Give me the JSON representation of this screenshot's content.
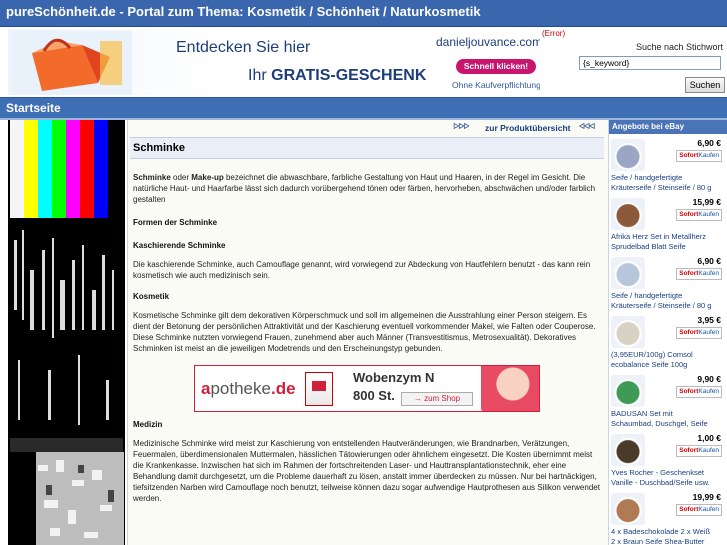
{
  "site": {
    "title": "pureSchönheit.de - Portal zum Thema: Kosmetik / Schönheit / Naturkosmetik"
  },
  "banner": {
    "line1": "Entdecken Sie hier",
    "line2_prefix": "Ihr ",
    "line2_bold": "GRATIS-GESCHENK",
    "brand": "danieljouvance.com",
    "cta": "Schnell klicken!",
    "note": "Ohne Kaufverpflichtung"
  },
  "error_link": "(Error)",
  "search": {
    "label": "Suche nach Stichwort",
    "value": "{s_keyword}",
    "button": "Suchen"
  },
  "nav": {
    "home": "Startseite"
  },
  "product_link": {
    "left_arrows": "ᐅᐅᐅ",
    "label": "zur Produktübersicht",
    "right_arrows": "ᐊᐊᐊ"
  },
  "article": {
    "title": "Schminke",
    "intro": {
      "b1": "Schminke",
      "t1": " oder ",
      "b2": "Make-up",
      "t2": " bezeichnet die abwaschbare, farbliche Gestaltung von Haut und Haaren, in der Regel im Gesicht. Die natürliche Haut- und Haarfarbe lässt sich dadurch vorübergehend tönen oder färben, hervorheben, abschwächen und/oder farblich gestalten"
    },
    "h_formen": "Formen der Schminke",
    "h_kaschierend": "Kaschierende Schminke",
    "p_kaschierend": "Die kaschierende Schminke, auch Camouflage genannt, wird vorwiegend zur Abdeckung von Hautfehlern benutzt - das kann rein kosmetisch wie auch medizinisch sein.",
    "h_kosmetik": "Kosmetik",
    "p_kosmetik": "Kosmetische Schminke gilt dem dekorativen Körperschmuck und soll im allgemeinen die Ausstrahlung einer Person steigern. Es dient der Betonung der persönlichen Attraktivität und der Kaschierung eventuell vorkommender Makel, wie Falten oder Couperose. Diese Schminke nutzten vorwiegend Frauen, zunehmend aber auch Männer (Transvestitismus, Metrosexualität). Dekoratives Schminken ist meist an die jeweiligen Modetrends und den Erscheinungstyp gebunden.",
    "h_medizin": "Medizin",
    "p_medizin": "Medizinische Schminke wird meist zur Kaschierung von entstellenden Hautveränderungen, wie Brandnarben, Verätzungen, Feuermalen, überdimensionalen Muttermalen, hässlichen Tätowierungen oder ähnlichem eingesetzt. Die Kosten übernimmt meist die Krankenkasse. Inzwischen hat sich im Rahmen der fortschreitenden Laser- und Hauttransplantationstechnik, eher eine Behandlung damit durchgesetzt, um die Probleme dauerhaft zu lösen, anstatt immer überdecken zu müssen. Nur bei hartnäckigen, tiefsitzenden Narben wird Camouflage noch benutzt, teilweise können dazu sogar aufwendige Hautprothesen aus Silikon verwendet werden."
  },
  "ad": {
    "brand_a": "a",
    "brand_rest": "potheke",
    "brand_tld": ".de",
    "product": "Wobenzym N",
    "qty": "800 St.",
    "button": "→ zum Shop"
  },
  "ebay": {
    "header": "Angebote bei eBay",
    "buy_label_red": "Sofort",
    "buy_label": "Kaufen",
    "items": [
      {
        "price": "6,90 €",
        "line1": "Seife / handgefertigte",
        "line2": "Kräuterseife / Steinseife / 80 g",
        "color": "#9aa6c4"
      },
      {
        "price": "15,99 €",
        "line1": "Afrika Herz Set in Metallherz",
        "line2": "Sprudelbad Blatt Seife",
        "color": "#8a5a3a"
      },
      {
        "price": "6,90 €",
        "line1": "Seife / handgefertigte",
        "line2": "Kräuterseife / Steinseife / 80 g",
        "color": "#b8c6dc"
      },
      {
        "price": "3,95 €",
        "line1": "(3,95EUR/100g) Comsol",
        "line2": "ecobalance Seife 100g",
        "color": "#d8d2c4"
      },
      {
        "price": "9,90 €",
        "line1": "BADUSAN Set mit",
        "line2": "Schaumbad, Duschgel, Seife",
        "color": "#3f9a55"
      },
      {
        "price": "1,00 €",
        "line1": "Yves Rocher - Geschenkset",
        "line2": "Vanille - Duschbad/Seife usw.",
        "color": "#4a3a2a"
      },
      {
        "price": "19,99 €",
        "line1": "4 x Badeschokolade 2 x Weiß",
        "line2": "2 x Braun Seife Shea-Butter",
        "color": "#b07a55"
      }
    ]
  },
  "colors": {
    "topbar": "#3a66ad",
    "nav": "#3e6eb4",
    "accent_red": "#d21f3c",
    "link": "#1a3f82"
  }
}
